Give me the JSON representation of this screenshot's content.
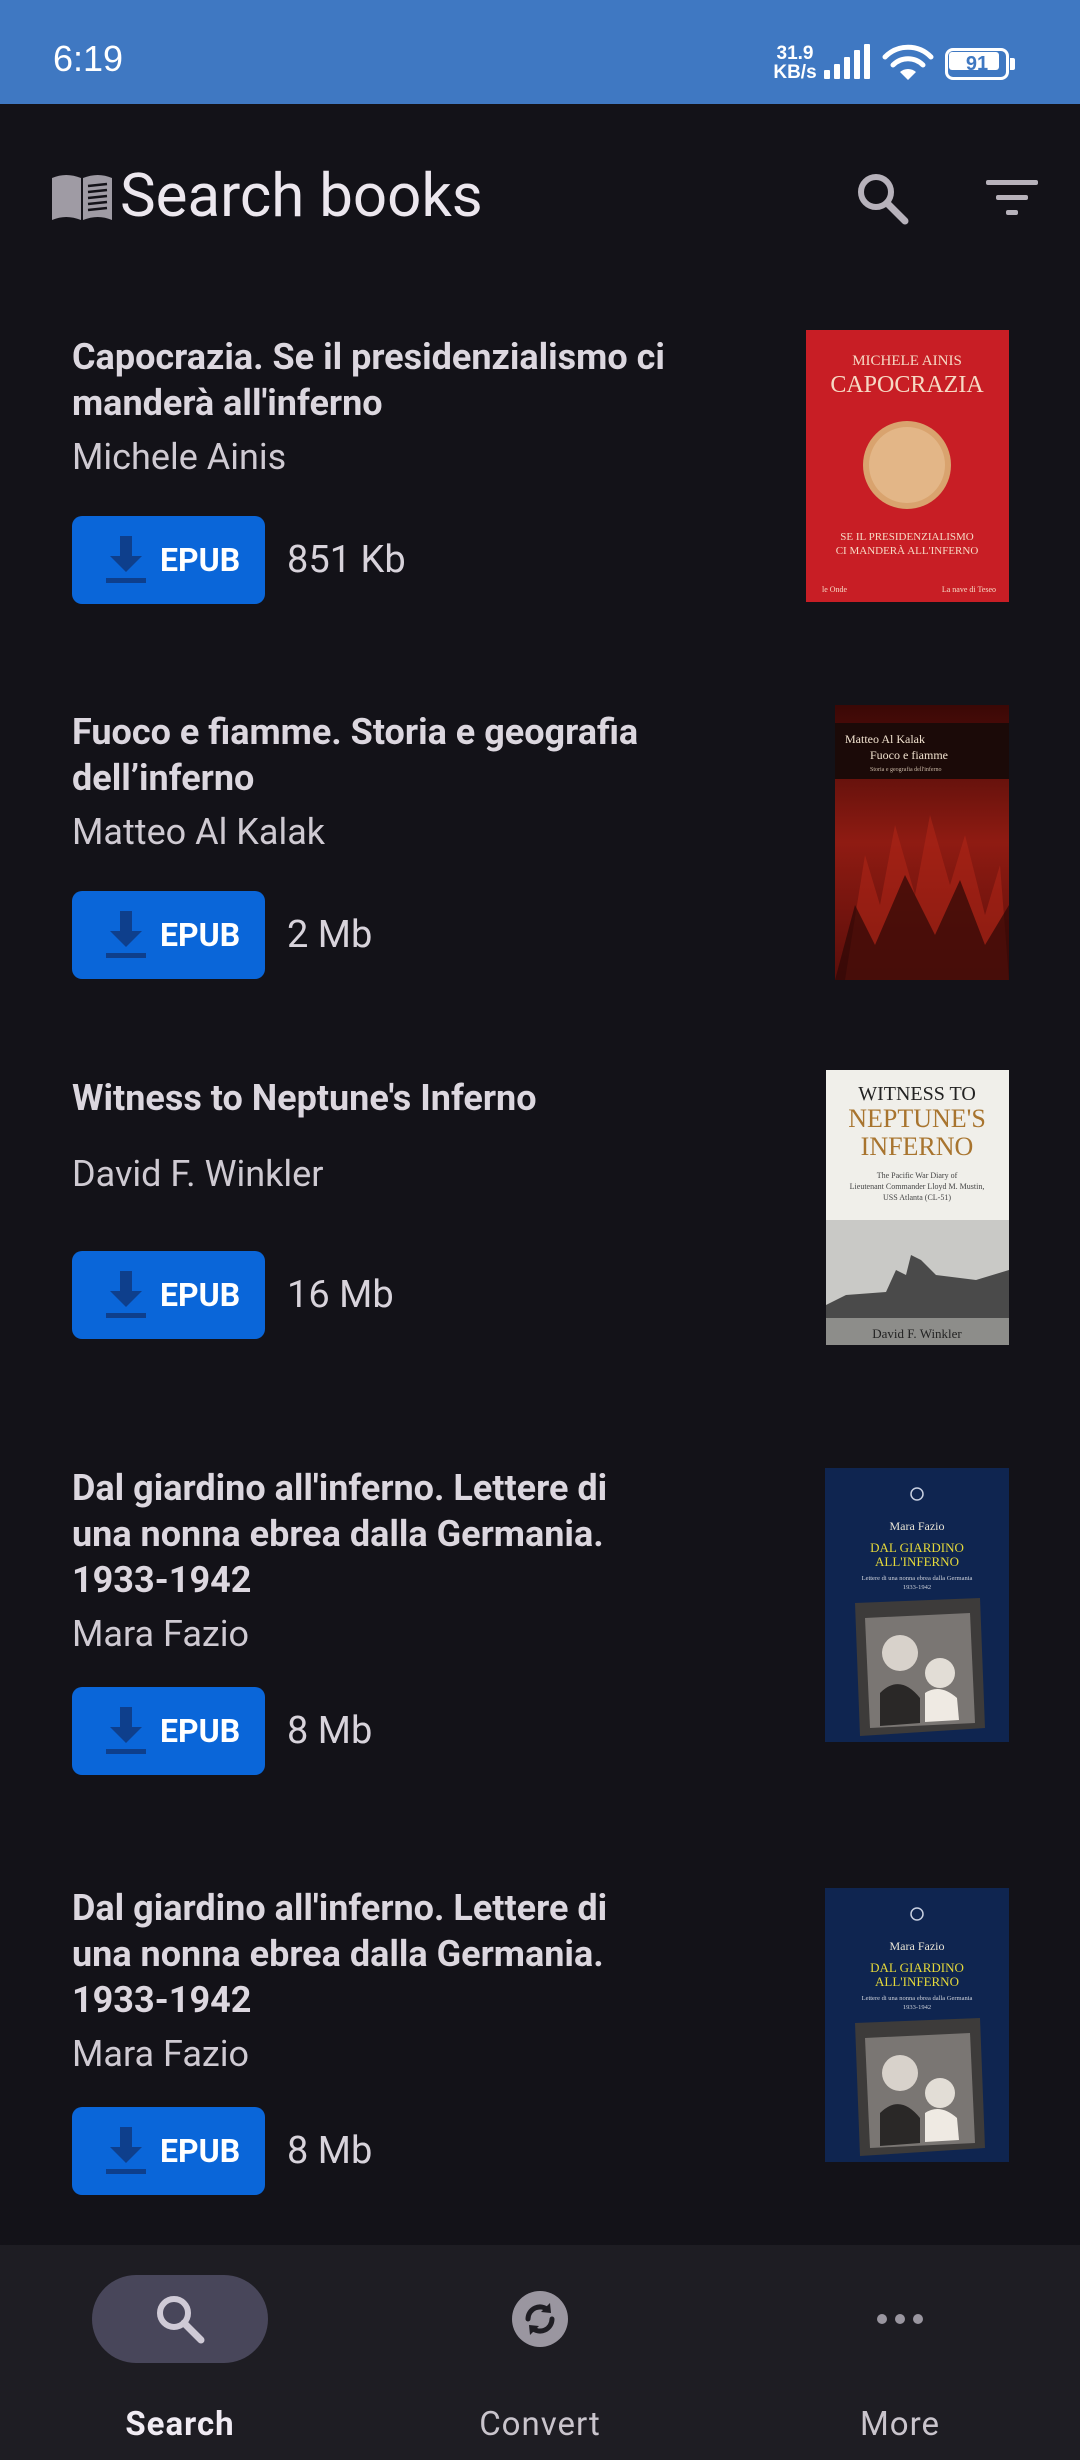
{
  "status_bar": {
    "time": "6:19",
    "speed_value": "31.9",
    "speed_unit": "KB/s",
    "battery": "91"
  },
  "app_bar": {
    "title": "Search books",
    "logo_icon": "open-book-icon",
    "search_icon": "search-icon",
    "filter_icon": "filter-icon"
  },
  "books": [
    {
      "title": "Capocrazia. Se il presidenzialismo ci manderà all'inferno",
      "author": "Michele Ainis",
      "format": "EPUB",
      "size": "851 Kb",
      "cover": {
        "top": "MICHELE AINIS",
        "main": "CAPOCRAZIA",
        "sub": "SE IL PRESIDENZIALISMO CI MANDERÀ ALL'INFERNO",
        "footer_left": "le Onde",
        "footer_right": "La nave di Teseo",
        "color": "#c81e25"
      }
    },
    {
      "title": "Fuoco e fiamme. Storia e geografia dell’inferno",
      "author": "Matteo Al Kalak",
      "format": "EPUB",
      "size": "2 Mb",
      "cover": {
        "top": "Matteo Al Kalak",
        "main": "Fuoco e fiamme",
        "sub": "Storia e geografia dell'inferno",
        "color": "#6e1410"
      }
    },
    {
      "title": "Witness to Neptune's Inferno",
      "author": "David F. Winkler",
      "format": "EPUB",
      "size": "16 Mb",
      "cover": {
        "top": "WITNESS TO",
        "main1": "NEPTUNE'S",
        "main2": "INFERNO",
        "sub": "The Pacific War Diary of Lieutenant Commander Lloyd M. Mustin, USS Atlanta (CL-51)",
        "footer": "David F. Winkler",
        "color": "#f0efea"
      }
    },
    {
      "title": "Dal giardino all'inferno. Lettere di una nonna ebrea dalla Germania. 1933-1942",
      "author": "Mara Fazio",
      "format": "EPUB",
      "size": "8 Mb",
      "cover": {
        "top": "Mara Fazio",
        "main1": "DAL GIARDINO",
        "main2": "ALL'INFERNO",
        "sub": "Lettere di una nonna ebrea dalla Germania 1933-1942",
        "color": "#0f2550"
      }
    },
    {
      "title": "Dal giardino all'inferno. Lettere di una nonna ebrea dalla Germania. 1933-1942",
      "author": "Mara Fazio",
      "format": "EPUB",
      "size": "8 Mb",
      "cover": {
        "top": "Mara Fazio",
        "main1": "DAL GIARDINO",
        "main2": "ALL'INFERNO",
        "sub": "Lettere di una nonna ebrea dalla Germania 1933-1942",
        "color": "#0f2550"
      }
    }
  ],
  "bottom_nav": [
    {
      "label": "Search",
      "icon": "search-icon",
      "active": true
    },
    {
      "label": "Convert",
      "icon": "convert-icon",
      "active": false
    },
    {
      "label": "More",
      "icon": "more-horizontal-icon",
      "active": false
    }
  ]
}
